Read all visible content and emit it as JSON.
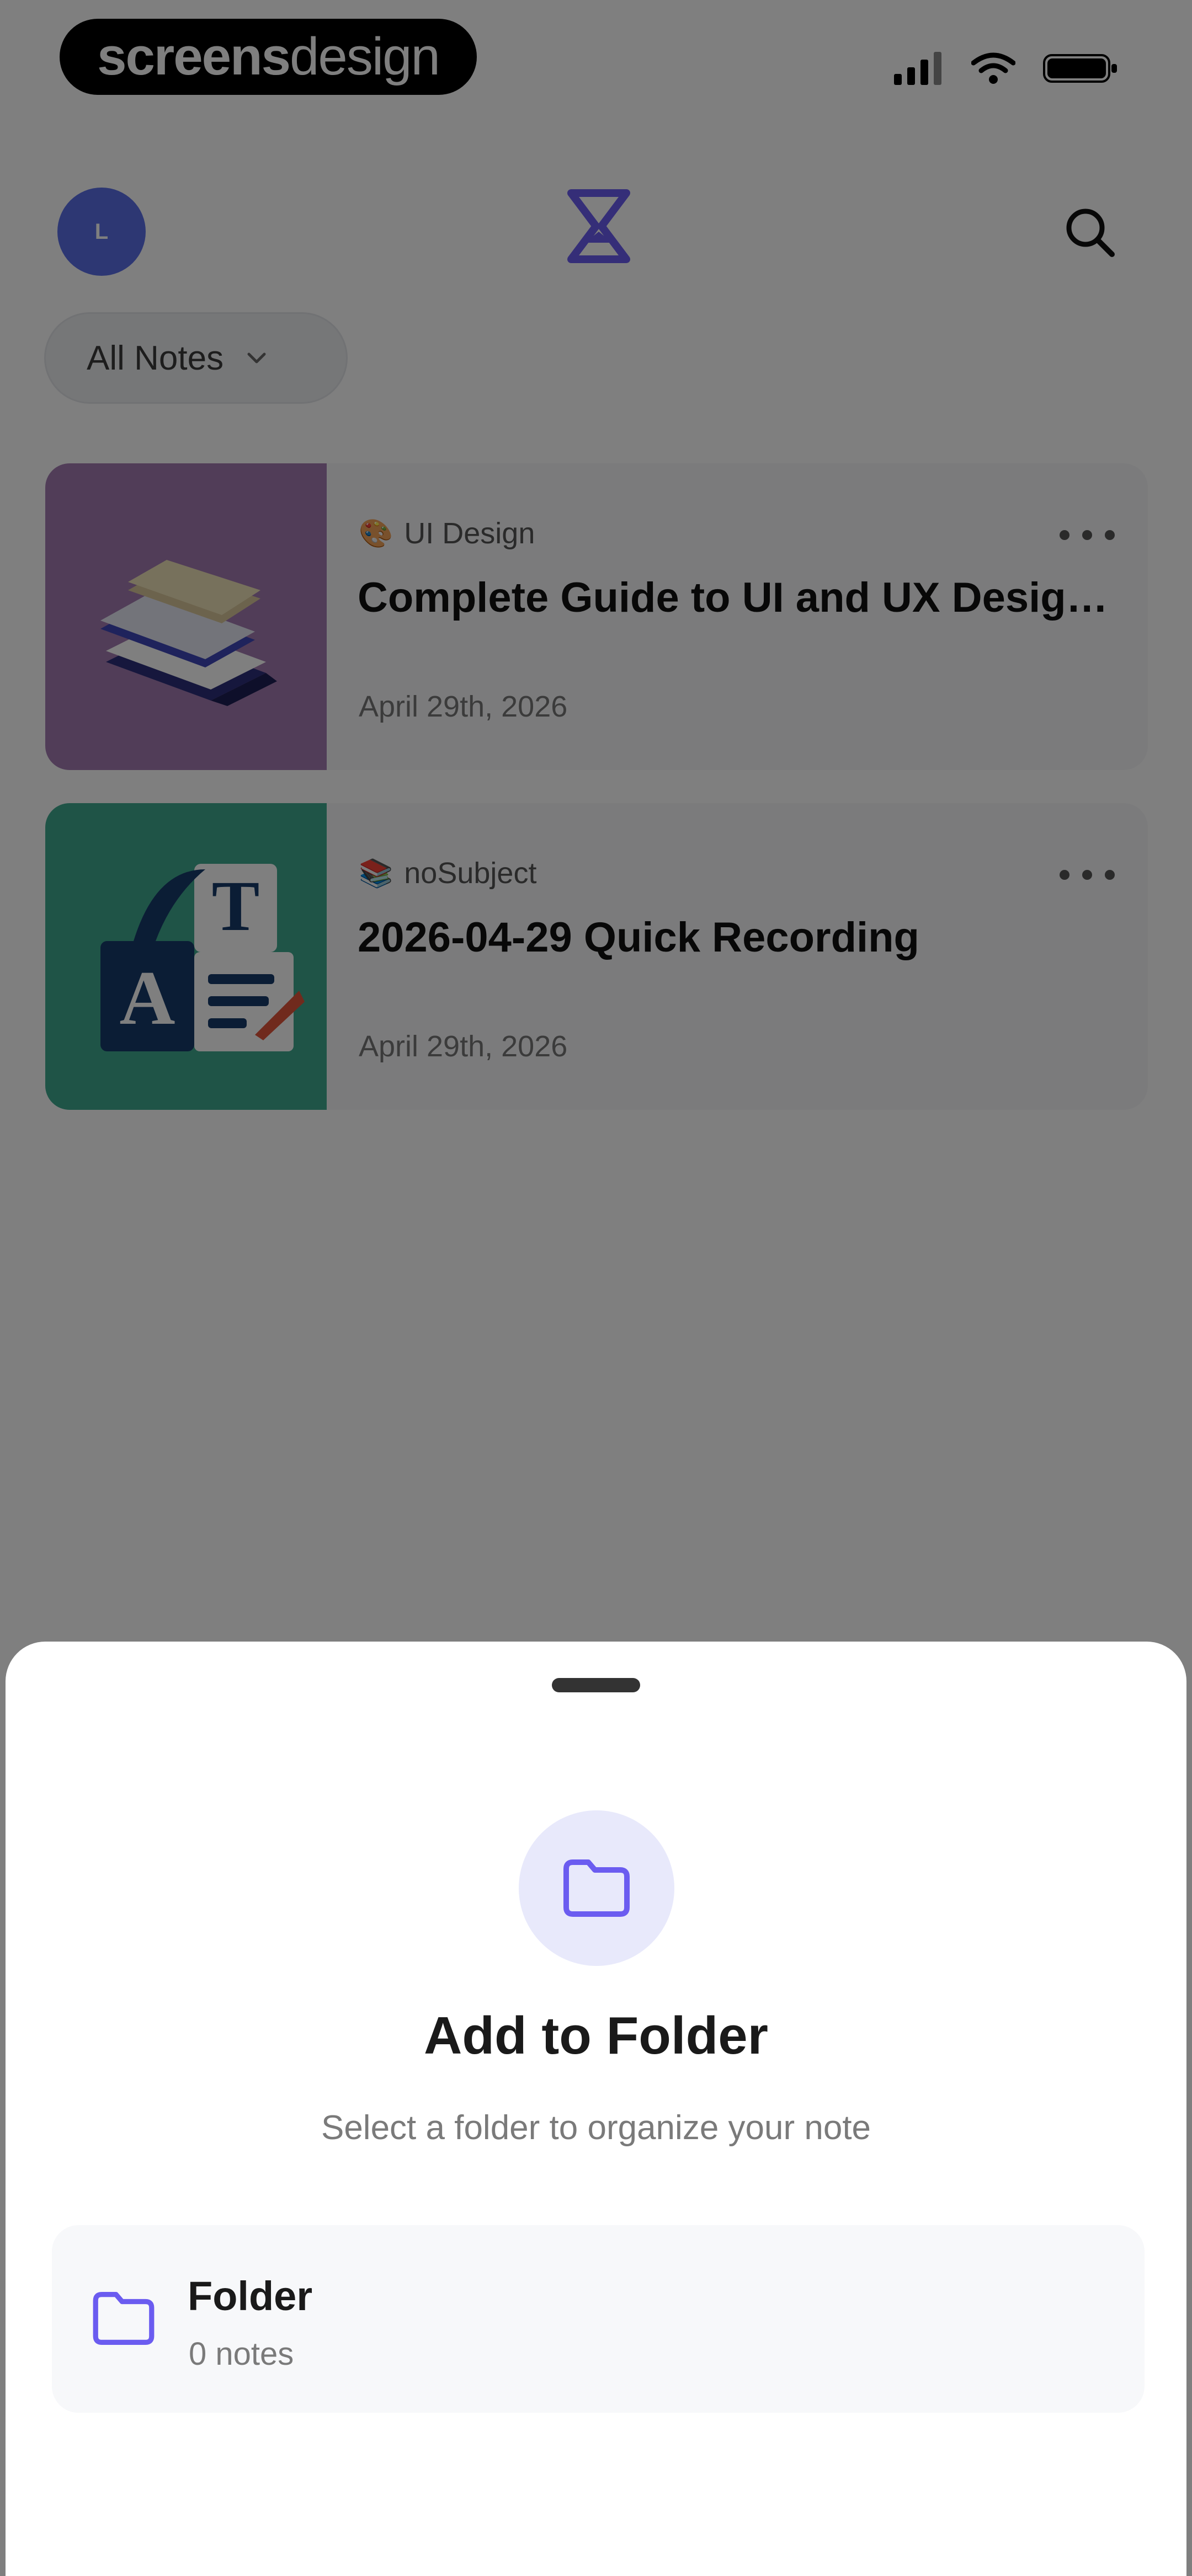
{
  "status_bar": {
    "brand_bold": "screens",
    "brand_light": "design"
  },
  "header": {
    "avatar_initial": "L",
    "logo_icon": "hourglass-logo-icon",
    "search_icon": "search-icon"
  },
  "filter": {
    "label": "All Notes"
  },
  "notes": [
    {
      "subject_emoji": "🎨",
      "subject": "UI Design",
      "title": "Complete Guide to UI and UX Design Pr...",
      "date": "April 29th, 2026",
      "thumb_color": "#a37bb0"
    },
    {
      "subject_emoji": "📚",
      "subject": "noSubject",
      "title": "2026-04-29 Quick Recording",
      "date": "April 29th, 2026",
      "thumb_color": "#3fa88f"
    }
  ],
  "sheet": {
    "title": "Add to Folder",
    "subtitle": "Select a folder to organize your note",
    "folders": [
      {
        "name": "Folder",
        "count": "0 notes"
      }
    ]
  },
  "colors": {
    "accent": "#6b5cf0",
    "avatar": "#5a6ee6",
    "icon_bg": "#e8e9fb"
  }
}
